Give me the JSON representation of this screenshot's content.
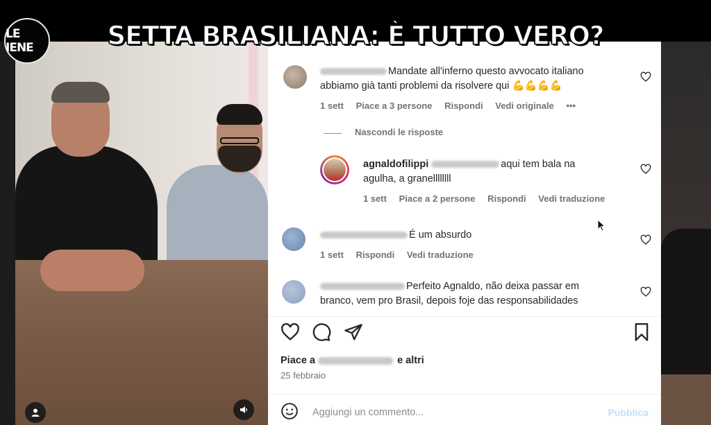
{
  "overlay": {
    "logo_text": "LE IENE",
    "headline": "SETTA BRASILIANA: È TUTTO VERO?"
  },
  "comments": [
    {
      "text_line1": "Mandate all'inferno questo avvocato italiano",
      "text_line2": "abbiamo già tanti problemi da risolvere qui 💪💪💪💪",
      "time": "1 sett",
      "likes": "Piace a 3 persone",
      "reply": "Rispondi",
      "translate": "Vedi originale",
      "more": "•••"
    },
    {
      "username": "agnaldofilippi",
      "text_line1": "aqui tem bala na",
      "text_line2": "agulha, a granellllllll",
      "time": "1 sett",
      "likes": "Piace a 2 persone",
      "reply": "Rispondi",
      "translate": "Vedi traduzione"
    },
    {
      "text_line1": "É um absurdo",
      "time": "1 sett",
      "reply": "Rispondi",
      "translate": "Vedi traduzione"
    },
    {
      "text_line1": "Perfeito Agnaldo, não deixa passar em",
      "text_line2": "branco, vem pro Brasil, depois foje das responsabilidades"
    }
  ],
  "hide_replies": "Nascondi le risposte",
  "post": {
    "likes_prefix": "Piace a",
    "likes_suffix": "e altri",
    "date": "25 febbraio"
  },
  "add_comment": {
    "placeholder": "Aggiungi un commento...",
    "publish": "Pubblica"
  },
  "icons": {
    "like": "heart-icon",
    "comment": "comment-icon",
    "share": "paper-plane-icon",
    "save": "bookmark-icon",
    "emoji": "emoji-icon",
    "user": "user-icon",
    "sound": "speaker-icon"
  },
  "colors": {
    "link_blue_disabled": "#c0dffd",
    "meta_gray": "#737373",
    "text": "#262626"
  }
}
